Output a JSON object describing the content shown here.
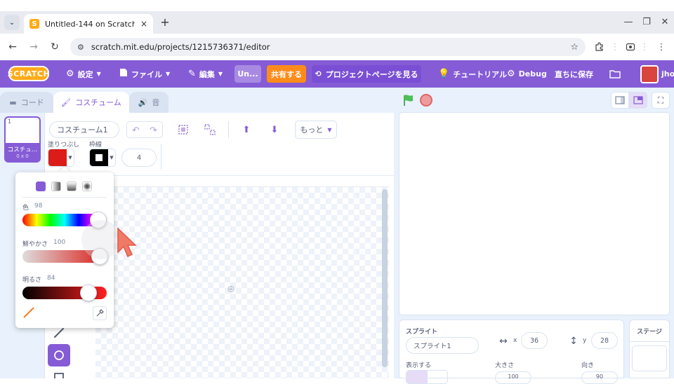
{
  "browser": {
    "tab_title": "Untitled-144 on Scratch",
    "tab_close": "×",
    "new_tab": "+",
    "url": "scratch.mit.edu/projects/1215736371/editor",
    "minimize": "—",
    "restore": "❐",
    "close": "✕"
  },
  "menubar": {
    "logo": "SCRATCH",
    "settings": "設定",
    "file": "ファイル",
    "edit": "編集",
    "project_title": "Un...",
    "share": "共有する",
    "project_page": "プロジェクトページを見る",
    "tutorials": "チュートリアル",
    "debug": "Debug",
    "save_now": "直ちに保存",
    "username": "jhoz"
  },
  "editor_tabs": {
    "code": "コード",
    "costumes": "コスチューム",
    "sounds": "音"
  },
  "costume_list": {
    "items": [
      {
        "number": "1",
        "name": "コスチュ…",
        "size": "0 x 0"
      }
    ]
  },
  "paint": {
    "costume_name": "コスチューム1",
    "more": "もっと",
    "fill_label": "塗りつぶし",
    "stroke_label": "枠線",
    "stroke_width": "4",
    "fill_color": "#dc1c18",
    "stroke_color": "#000000"
  },
  "color_picker": {
    "color_label": "色",
    "color_value": 98,
    "saturation_label": "鮮やかさ",
    "saturation_value": 100,
    "brightness_label": "明るさ",
    "brightness_value": 84,
    "slider_max": 100
  },
  "sprite_info": {
    "sprite_label": "スプライト",
    "sprite_name": "スプライト1",
    "x_label": "x",
    "x_value": "36",
    "y_label": "y",
    "y_value": "28",
    "show_label": "表示する",
    "size_label": "大きさ",
    "size_value": "100",
    "direction_label": "向き",
    "direction_value": "90"
  },
  "stage_panel": {
    "label": "ステージ"
  },
  "colors": {
    "accent": "#855cd6",
    "share": "#ff8c1a",
    "logo": "#ffab19"
  }
}
